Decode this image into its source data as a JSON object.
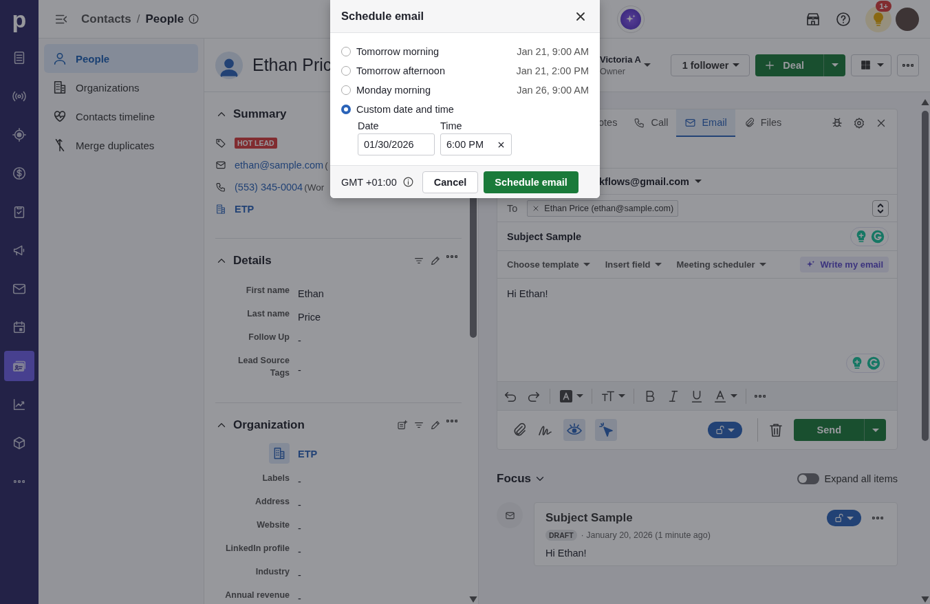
{
  "rail": {
    "logo": "p",
    "items": [
      {
        "kind": "document",
        "selected": false
      },
      {
        "kind": "signal",
        "selected": false
      },
      {
        "kind": "target",
        "selected": false
      },
      {
        "kind": "dollar",
        "selected": false
      },
      {
        "kind": "clipboard",
        "selected": false
      },
      {
        "kind": "megaphone",
        "selected": false
      },
      {
        "kind": "mail",
        "selected": false
      },
      {
        "kind": "calendar",
        "selected": false
      },
      {
        "kind": "contact-card",
        "selected": true
      },
      {
        "kind": "chart",
        "selected": false
      },
      {
        "kind": "box",
        "selected": false
      },
      {
        "kind": "more",
        "selected": false
      }
    ]
  },
  "topbar": {
    "breadcrumb_parent": "Contacts",
    "separator": "/",
    "breadcrumb_current": "People",
    "notification_badge": "1+"
  },
  "nav": {
    "items": [
      {
        "kind": "person",
        "label": "People",
        "selected": true
      },
      {
        "kind": "building",
        "label": "Organizations",
        "selected": false
      },
      {
        "kind": "heart-pulse",
        "label": "Contacts timeline",
        "selected": false
      },
      {
        "kind": "merge",
        "label": "Merge duplicates",
        "selected": false
      }
    ]
  },
  "person": {
    "name": "Ethan Pric",
    "summary": {
      "title": "Summary",
      "label_tag": "HOT LEAD",
      "email": "ethan@sample.com",
      "email_note": "(",
      "phone": "(553) 345-0004",
      "phone_note": "(Wor",
      "organization": "ETP"
    },
    "details": {
      "title": "Details",
      "fields": [
        {
          "label": "First name",
          "value": "Ethan"
        },
        {
          "label": "Last name",
          "value": "Price"
        },
        {
          "label": "Follow Up",
          "value": "-"
        },
        {
          "label": "Lead Source",
          "label_continued": "Tags",
          "value": "-"
        }
      ]
    },
    "organization": {
      "title": "Organization",
      "name": "ETP",
      "fields": [
        {
          "label": "Labels",
          "value": "-"
        },
        {
          "label": "Address",
          "value": "-"
        },
        {
          "label": "Website",
          "value": "-"
        },
        {
          "label": "LinkedIn profile",
          "value": "-"
        },
        {
          "label": "Industry",
          "value": "-"
        },
        {
          "label": "Annual revenue",
          "value": "-"
        }
      ]
    }
  },
  "header": {
    "owner_name": "Victoria A",
    "owner_role": "Owner",
    "followers": "1 follower",
    "deal": "Deal"
  },
  "composer": {
    "tabs": [
      {
        "kind": "notes",
        "label": "otes",
        "selected": false
      },
      {
        "kind": "call",
        "label": "Call",
        "selected": false
      },
      {
        "kind": "email",
        "label": "Email",
        "selected": true
      },
      {
        "kind": "files",
        "label": "Files",
        "selected": false
      }
    ],
    "from": "kflows@gmail.com",
    "to_label": "To",
    "recipient": "Ethan Price (ethan@sample.com)",
    "subject": "Subject Sample",
    "menus": [
      {
        "label": "Choose template"
      },
      {
        "label": "Insert field"
      },
      {
        "label": "Meeting scheduler"
      }
    ],
    "ai_button": "Write my email",
    "body": "Hi Ethan!",
    "tracking": [
      {
        "kind": "eye",
        "on": true
      },
      {
        "kind": "cursor",
        "on": true
      }
    ],
    "send": "Send"
  },
  "focus": {
    "title": "Focus",
    "expand_label": "Expand all items",
    "expand_on": false,
    "items": [
      {
        "title": "Subject Sample",
        "status": "DRAFT",
        "meta": "· January 20, 2026 (1 minute ago)",
        "body": "Hi Ethan!"
      }
    ]
  },
  "modal": {
    "title": "Schedule email",
    "options": [
      {
        "kind": "preset",
        "label": "Tomorrow morning",
        "time": "Jan 21, 9:00 AM",
        "selected": false
      },
      {
        "kind": "preset",
        "label": "Tomorrow afternoon",
        "time": "Jan 21, 2:00 PM",
        "selected": false
      },
      {
        "kind": "preset",
        "label": "Monday morning",
        "time": "Jan 26, 9:00 AM",
        "selected": false
      },
      {
        "kind": "custom",
        "label": "Custom date and time",
        "selected": true
      }
    ],
    "date_label": "Date",
    "date_value": "01/30/2026",
    "time_label": "Time",
    "time_value": "6:00 PM",
    "timezone": "GMT +01:00",
    "cancel": "Cancel",
    "confirm": "Schedule email"
  }
}
